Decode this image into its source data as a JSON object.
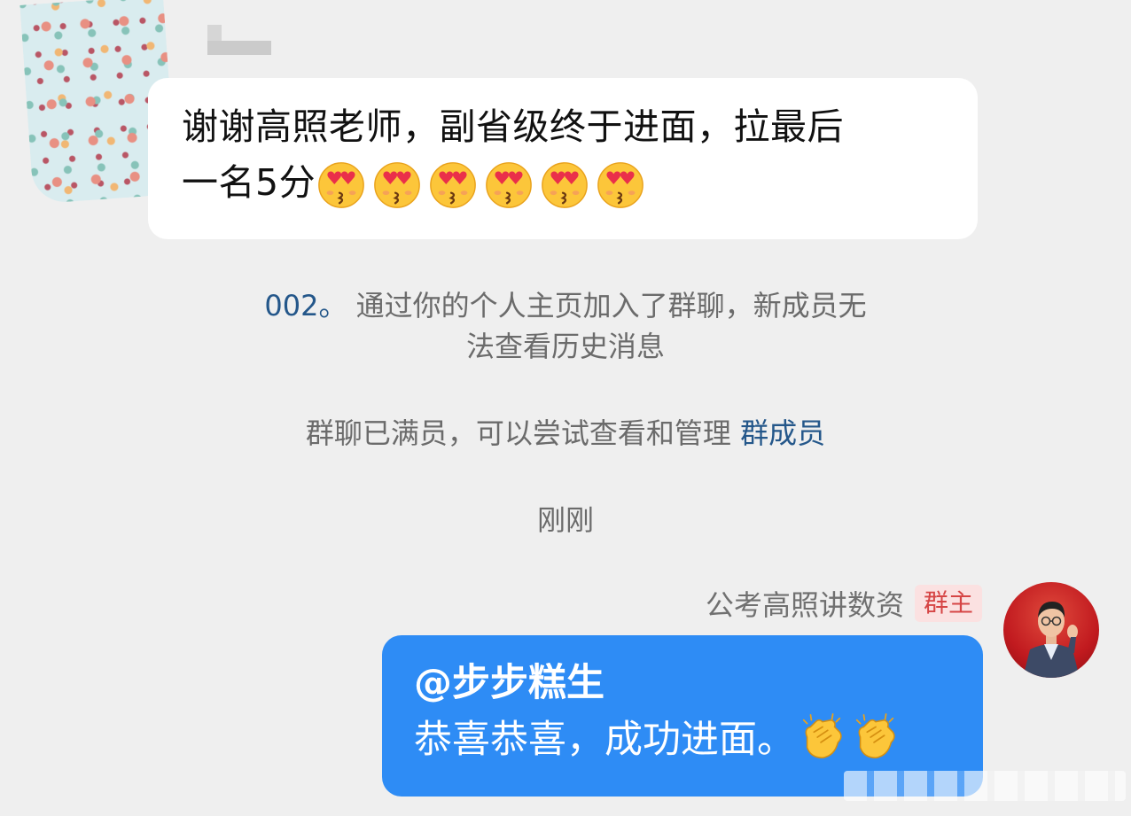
{
  "incoming": {
    "text_line1": "谢谢高照老师，副省级终于进面，拉最后",
    "text_line2": "一名5分",
    "emoji": "smiling-face-with-heart-eyes-kiss",
    "emoji_count": 6
  },
  "system": {
    "join_user": "002。",
    "join_text": " 通过你的个人主页加入了群聊，新成员无法查看历史消息",
    "full_text": "群聊已满员，可以尝试查看和管理 ",
    "full_link": "群成员",
    "time": "刚刚"
  },
  "outgoing": {
    "sender_name": "公考高照讲数资",
    "badge": "群主",
    "mention": "@步步糕生",
    "text": "恭喜恭喜，成功进面。",
    "emoji": "clapping-hands",
    "emoji_count": 2
  },
  "colors": {
    "background": "#efefef",
    "bubble_in": "#ffffff",
    "bubble_out": "#2e8cf5",
    "link": "#24578a",
    "badge_text": "#d64545",
    "badge_bg": "#fbe1e1"
  }
}
